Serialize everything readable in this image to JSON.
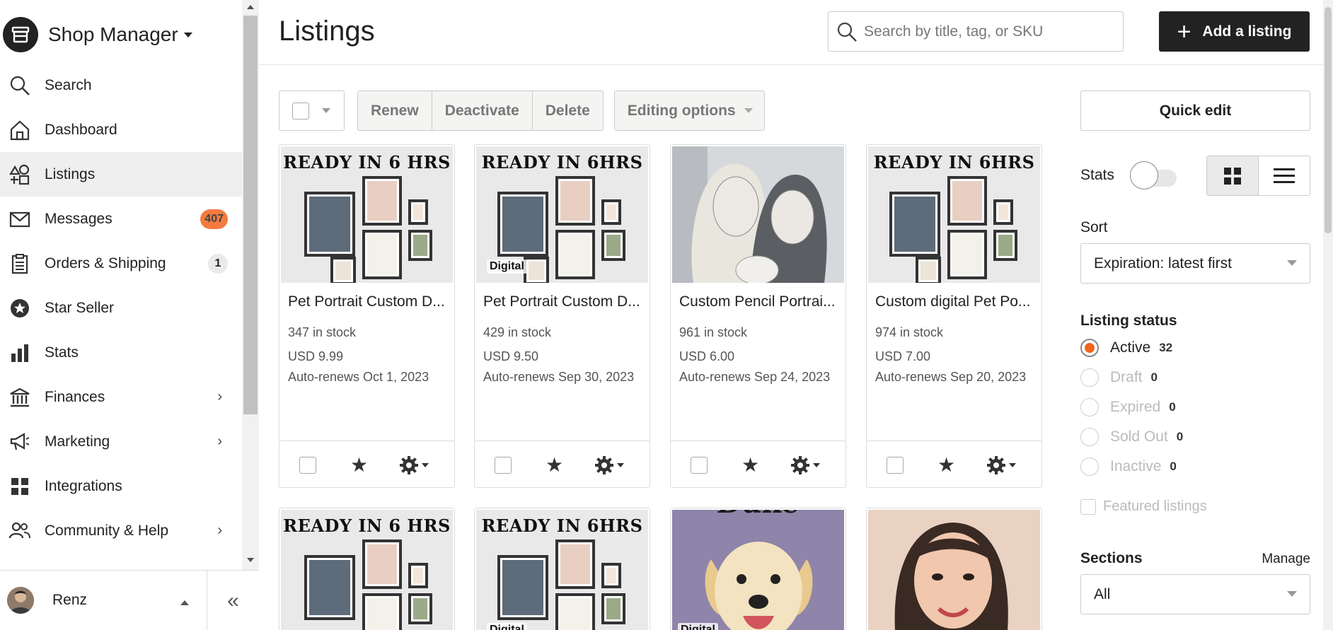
{
  "sidebar": {
    "shop_title": "Shop Manager",
    "items": [
      {
        "label": "Search",
        "icon": "search-icon"
      },
      {
        "label": "Dashboard",
        "icon": "home-icon"
      },
      {
        "label": "Listings",
        "icon": "shapes-icon",
        "active": true
      },
      {
        "label": "Messages",
        "icon": "mail-icon",
        "badge": "407"
      },
      {
        "label": "Orders & Shipping",
        "icon": "clipboard-icon",
        "badge": "1"
      },
      {
        "label": "Star Seller",
        "icon": "star-badge-icon"
      },
      {
        "label": "Stats",
        "icon": "bar-chart-icon"
      },
      {
        "label": "Finances",
        "icon": "bank-icon",
        "expandable": true
      },
      {
        "label": "Marketing",
        "icon": "megaphone-icon",
        "expandable": true
      },
      {
        "label": "Integrations",
        "icon": "grid-icon"
      },
      {
        "label": "Community & Help",
        "icon": "people-icon",
        "expandable": true
      }
    ],
    "user_name": "Renz"
  },
  "header": {
    "title": "Listings",
    "search_placeholder": "Search by title, tag, or SKU",
    "add_label": "Add a listing"
  },
  "toolbar": {
    "renew": "Renew",
    "deactivate": "Deactivate",
    "delete": "Delete",
    "editing_options": "Editing options"
  },
  "listings": [
    {
      "title": "Pet Portrait Custom D...",
      "stock": "347 in stock",
      "price": "USD 9.99",
      "renews": "Auto-renews Oct 1, 2023",
      "image": "ready-6-hrs-frames"
    },
    {
      "title": "Pet Portrait Custom D...",
      "stock": "429 in stock",
      "price": "USD 9.50",
      "renews": "Auto-renews Sep 30, 2023",
      "image": "ready-6hrs-frames-digital"
    },
    {
      "title": "Custom Pencil Portrai...",
      "stock": "961 in stock",
      "price": "USD 6.00",
      "renews": "Auto-renews Sep 24, 2023",
      "image": "pencil-portrait"
    },
    {
      "title": "Custom digital Pet Po...",
      "stock": "974 in stock",
      "price": "USD 7.00",
      "renews": "Auto-renews Sep 20, 2023",
      "image": "ready-6hrs-frames"
    }
  ],
  "card_text": {
    "ready_a": "READY IN 6 HRS",
    "ready_b": "READY IN 6HRS",
    "digital": "Digital",
    "duke": "Duke"
  },
  "right_panel": {
    "quick_edit": "Quick edit",
    "stats_label": "Stats",
    "sort_label": "Sort",
    "sort_value": "Expiration: latest first",
    "status_heading": "Listing status",
    "statuses": [
      {
        "label": "Active",
        "count": "32",
        "checked": true
      },
      {
        "label": "Draft",
        "count": "0"
      },
      {
        "label": "Expired",
        "count": "0"
      },
      {
        "label": "Sold Out",
        "count": "0"
      },
      {
        "label": "Inactive",
        "count": "0"
      }
    ],
    "featured_label": "Featured listings",
    "sections_heading": "Sections",
    "manage_label": "Manage",
    "sections_value": "All"
  },
  "colors": {
    "accent": "#f1641e",
    "dark": "#222222"
  }
}
